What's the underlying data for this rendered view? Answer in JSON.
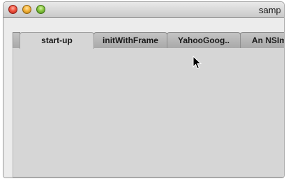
{
  "window": {
    "title": "samp",
    "buttons": {
      "close": "close-button",
      "minimize": "minimize-button",
      "zoom": "zoom-button"
    }
  },
  "tabs": [
    {
      "label": "start-up",
      "selected": true
    },
    {
      "label": "initWithFrame",
      "selected": false
    },
    {
      "label": "YahooGoog..",
      "selected": false
    },
    {
      "label": "An NSIm",
      "selected": false
    }
  ],
  "colors": {
    "close": "#f0533e",
    "minimize": "#f5b33a",
    "zoom": "#86c53f",
    "tab_panel": "#d6d6d6"
  },
  "icons": [
    "arrow-cursor-icon"
  ]
}
